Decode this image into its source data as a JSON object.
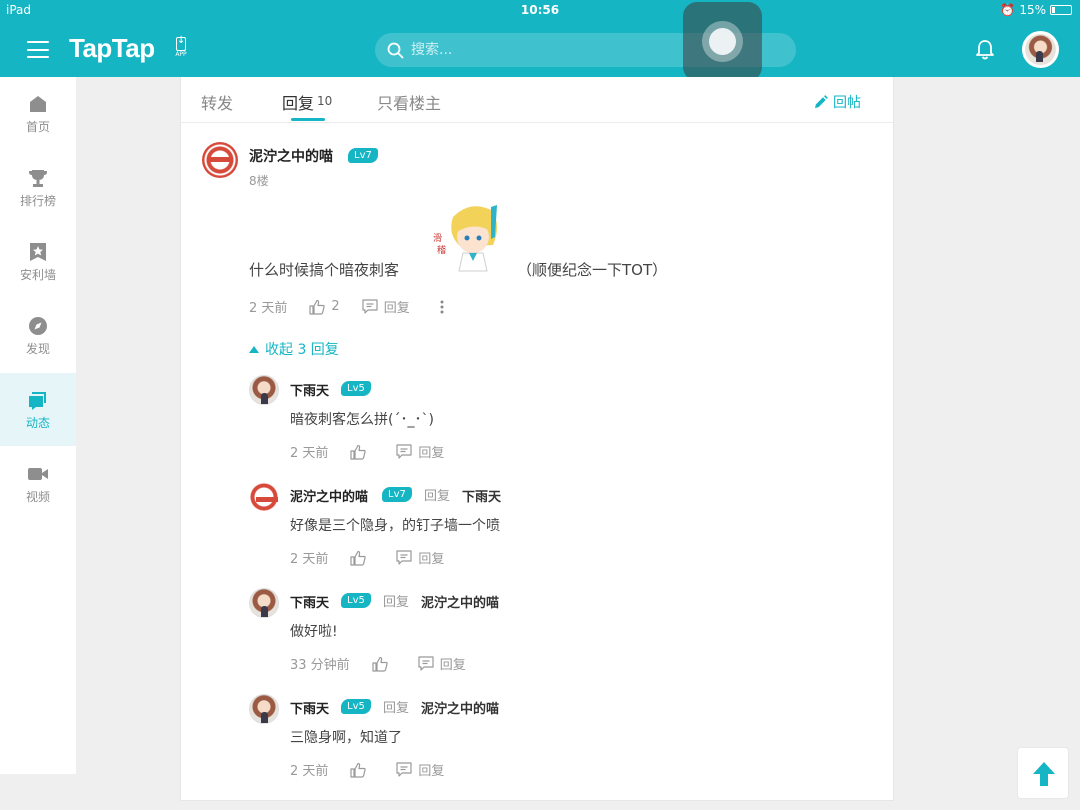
{
  "status_bar": {
    "device": "iPad",
    "time": "10:56",
    "battery": "15%"
  },
  "header": {
    "logo": "TapTap",
    "app_label": "APP",
    "search_placeholder": "搜索..."
  },
  "sidebar": {
    "items": [
      {
        "label": "首页",
        "icon": "home-icon"
      },
      {
        "label": "排行榜",
        "icon": "trophy-icon"
      },
      {
        "label": "安利墙",
        "icon": "star-icon"
      },
      {
        "label": "发现",
        "icon": "compass-icon"
      },
      {
        "label": "动态",
        "icon": "feed-icon",
        "active": true
      },
      {
        "label": "视频",
        "icon": "video-icon"
      }
    ]
  },
  "tabs": [
    {
      "label": "转发"
    },
    {
      "label": "回复",
      "count": "10",
      "active": true
    },
    {
      "label": "只看楼主"
    }
  ],
  "reply_post_label": "回帖",
  "main_comment": {
    "user": "泥泞之中的喵",
    "level": "Lv7",
    "floor": "8楼",
    "text_before": "什么时候搞个暗夜刺客",
    "text_after": "（顺便纪念一下TOT）",
    "time": "2 天前",
    "likes": "2",
    "reply_label": "回复"
  },
  "collapse_label": "收起 3 回复",
  "replies": [
    {
      "user": "下雨天",
      "level": "Lv5",
      "reply_word": "",
      "target": "",
      "text": "暗夜刺客怎么拼(´･_･`)",
      "time": "2 天前",
      "reply_label": "回复",
      "avatar": "girl"
    },
    {
      "user": "泥泞之中的喵",
      "level": "Lv7",
      "reply_word": "回复",
      "target": "下雨天",
      "text": "好像是三个隐身，的钉子墙一个喷",
      "time": "2 天前",
      "reply_label": "回复",
      "avatar": "red"
    },
    {
      "user": "下雨天",
      "level": "Lv5",
      "reply_word": "回复",
      "target": "泥泞之中的喵",
      "text": "做好啦!",
      "time": "33 分钟前",
      "reply_label": "回复",
      "avatar": "girl"
    },
    {
      "user": "下雨天",
      "level": "Lv5",
      "reply_word": "回复",
      "target": "泥泞之中的喵",
      "text": "三隐身啊，知道了",
      "time": "2 天前",
      "reply_label": "回复",
      "avatar": "girl"
    }
  ],
  "colors": {
    "brand": "#16b5c4"
  }
}
